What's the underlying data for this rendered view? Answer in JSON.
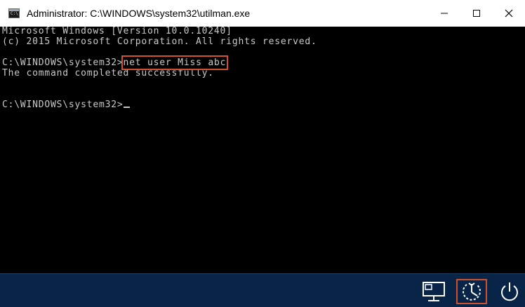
{
  "window": {
    "title": "Administrator: C:\\WINDOWS\\system32\\utilman.exe",
    "controls": [
      "minimize-icon",
      "maximize-icon",
      "close-icon"
    ]
  },
  "console": {
    "lines": [
      "Microsoft Windows [Version 10.0.10240]",
      "(c) 2015 Microsoft Corporation. All rights reserved.",
      "",
      "C:\\WINDOWS\\system32>",
      "The command completed successfully.",
      "",
      "",
      "C:\\WINDOWS\\system32>"
    ],
    "command": "net user Miss abc"
  },
  "tray": {
    "icons": [
      "network-icon",
      "ease-of-access-icon",
      "power-icon"
    ],
    "accent": "#d3502c"
  }
}
